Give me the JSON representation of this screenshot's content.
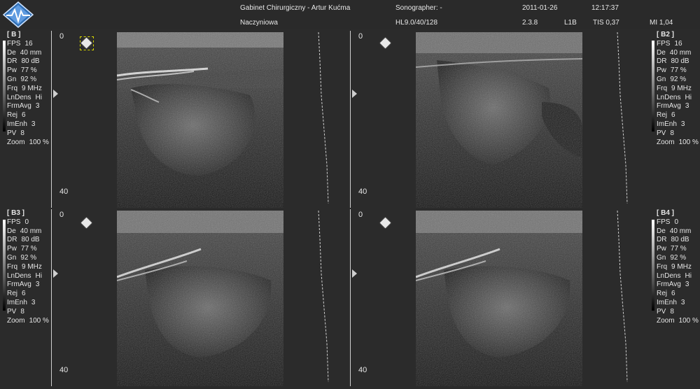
{
  "header": {
    "clinic": "Gabinet Chirurgiczny - Artur Kućma",
    "exam": "Naczyniowa",
    "sonographer": "Sonographer: -",
    "probe": "HL9.0/40/128",
    "date": "2011-01-26",
    "version": "2.3.8",
    "time": "12:17:37",
    "mode_code": "L1B",
    "tis": "TIS 0,37",
    "mi": "MI 1,04"
  },
  "panels": [
    {
      "id": "B",
      "title": "[ B ]",
      "depth_top": "0",
      "depth_bottom": "40",
      "params": [
        {
          "k": "FPS",
          "v": "16"
        },
        {
          "k": "De",
          "v": "40 mm"
        },
        {
          "k": "DR",
          "v": "80 dB"
        },
        {
          "k": "Pw",
          "v": "77 %"
        },
        {
          "k": "Gn",
          "v": "92 %"
        },
        {
          "k": "Frq",
          "v": "9 MHz"
        },
        {
          "k": "LnDens",
          "v": "Hi"
        },
        {
          "k": "FrmAvg",
          "v": "3"
        },
        {
          "k": "Rej",
          "v": "6"
        },
        {
          "k": "ImEnh",
          "v": "3"
        },
        {
          "k": "PV",
          "v": "8"
        },
        {
          "k": "Zoom",
          "v": "100 %"
        }
      ]
    },
    {
      "id": "B2",
      "title": "[ B2 ]",
      "depth_top": "0",
      "depth_bottom": "40",
      "params": [
        {
          "k": "FPS",
          "v": "16"
        },
        {
          "k": "De",
          "v": "40 mm"
        },
        {
          "k": "DR",
          "v": "80 dB"
        },
        {
          "k": "Pw",
          "v": "77 %"
        },
        {
          "k": "Gn",
          "v": "92 %"
        },
        {
          "k": "Frq",
          "v": "9 MHz"
        },
        {
          "k": "LnDens",
          "v": "Hi"
        },
        {
          "k": "FrmAvg",
          "v": "3"
        },
        {
          "k": "Rej",
          "v": "6"
        },
        {
          "k": "ImEnh",
          "v": "3"
        },
        {
          "k": "PV",
          "v": "8"
        },
        {
          "k": "Zoom",
          "v": "100 %"
        }
      ]
    },
    {
      "id": "B3",
      "title": "[ B3 ]",
      "depth_top": "0",
      "depth_bottom": "40",
      "params": [
        {
          "k": "FPS",
          "v": "0"
        },
        {
          "k": "De",
          "v": "40 mm"
        },
        {
          "k": "DR",
          "v": "80 dB"
        },
        {
          "k": "Pw",
          "v": "77 %"
        },
        {
          "k": "Gn",
          "v": "92 %"
        },
        {
          "k": "Frq",
          "v": "9 MHz"
        },
        {
          "k": "LnDens",
          "v": "Hi"
        },
        {
          "k": "FrmAvg",
          "v": "3"
        },
        {
          "k": "Rej",
          "v": "6"
        },
        {
          "k": "ImEnh",
          "v": "3"
        },
        {
          "k": "PV",
          "v": "8"
        },
        {
          "k": "Zoom",
          "v": "100 %"
        }
      ]
    },
    {
      "id": "B4",
      "title": "[ B4 ]",
      "depth_top": "0",
      "depth_bottom": "40",
      "params": [
        {
          "k": "FPS",
          "v": "0"
        },
        {
          "k": "De",
          "v": "40 mm"
        },
        {
          "k": "DR",
          "v": "80 dB"
        },
        {
          "k": "Pw",
          "v": "77 %"
        },
        {
          "k": "Gn",
          "v": "92 %"
        },
        {
          "k": "Frq",
          "v": "9 MHz"
        },
        {
          "k": "LnDens",
          "v": "Hi"
        },
        {
          "k": "FrmAvg",
          "v": "3"
        },
        {
          "k": "Rej",
          "v": "6"
        },
        {
          "k": "ImEnh",
          "v": "3"
        },
        {
          "k": "PV",
          "v": "8"
        },
        {
          "k": "Zoom",
          "v": "100 %"
        }
      ]
    }
  ],
  "icons": {
    "logo": "ultrasound-logo-icon",
    "focus": "focus-diamond-icon",
    "depth_marker": "depth-marker-icon"
  },
  "colors": {
    "background": "#2b2b2b",
    "image_bg": "#1b1b1b",
    "text": "#e6e6e6",
    "logo_blue": "#2f6fb5",
    "focus_box": "#d6d600"
  }
}
